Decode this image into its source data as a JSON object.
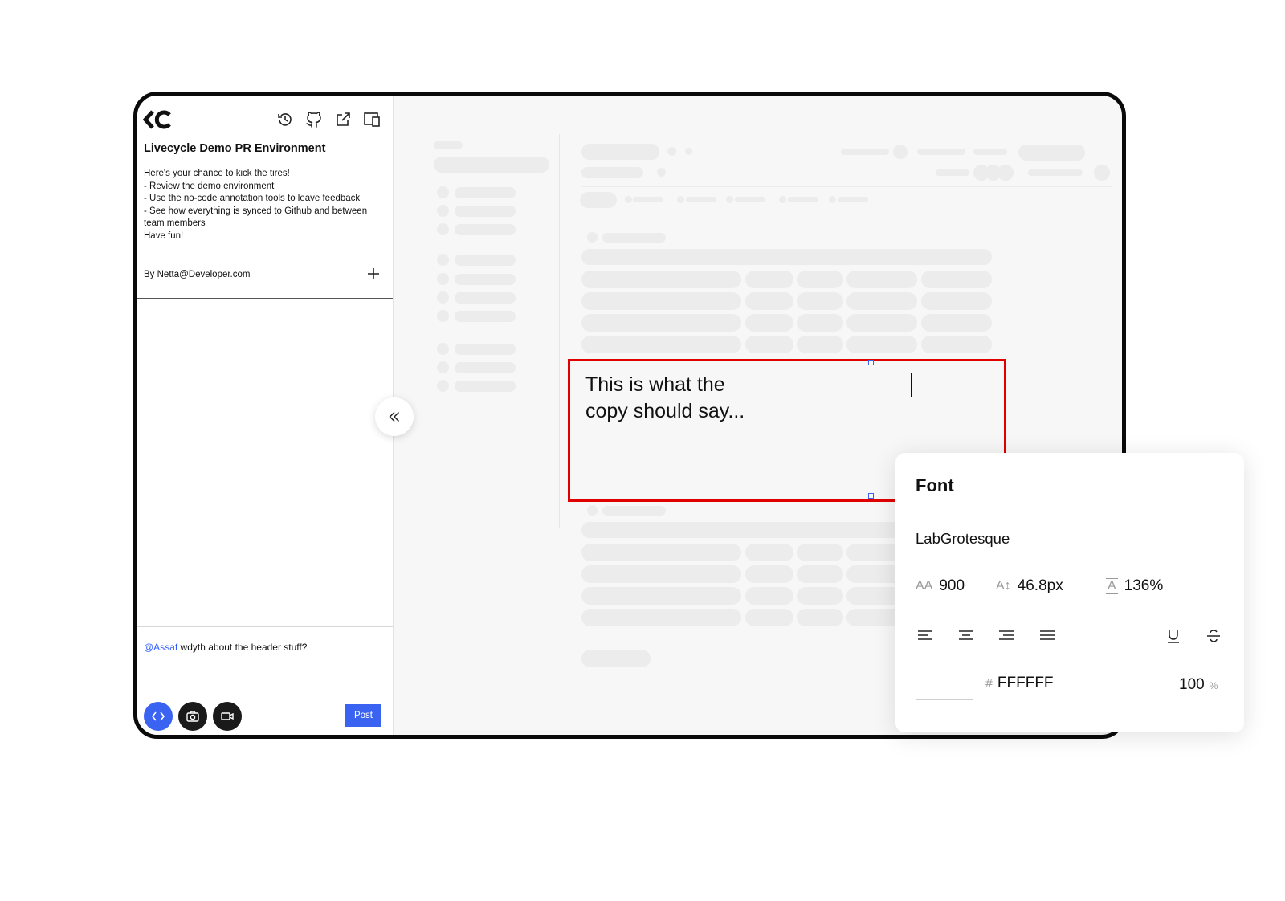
{
  "sidebar": {
    "title": "Livecycle Demo PR Environment",
    "description": [
      "Here's your chance to kick the tires!",
      "- Review the demo environment",
      "- Use the no-code annotation tools to leave feedback",
      "- See how everything is synced to Github and between team members",
      "Have fun!"
    ],
    "author": "By Netta@Developer.com",
    "toolbar_icons": [
      "history-icon",
      "github-icon",
      "external-link-icon",
      "devices-icon"
    ]
  },
  "comment": {
    "mention": "@Assaf",
    "text": " wdyth about the header stuff?",
    "post_label": "Post"
  },
  "annotation": {
    "text_line1": "This is what the",
    "text_line2": "copy should say..."
  },
  "font_panel": {
    "title": "Font",
    "family": "LabGrotesque",
    "weight": "900",
    "size": "46.8px",
    "line_height": "136%",
    "color_hash": "#",
    "color_hex": "FFFFFF",
    "opacity": "100",
    "opacity_unit": "%",
    "weight_icon": "AA",
    "size_icon": "A↕",
    "line_height_icon": "A"
  },
  "colors": {
    "accent": "#3a63f2",
    "annotation_border": "#e00000",
    "dark_button": "#1a1a1a"
  }
}
